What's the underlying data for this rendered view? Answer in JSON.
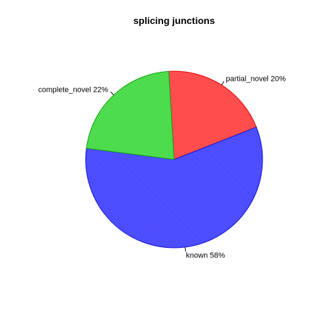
{
  "chart_data": {
    "type": "pie",
    "title": "splicing junctions",
    "start_angle_deg": 93.5,
    "direction": "clockwise",
    "slices": [
      {
        "label": "partial_novel 20%",
        "value": 20,
        "color": "#ff5555",
        "edge": "#e00000",
        "hatch": "#ff0000"
      },
      {
        "label": "known 58%",
        "value": 58,
        "color": "#5555ff",
        "edge": "#1010d0",
        "hatch": "#0000ff"
      },
      {
        "label": "complete_novel 22%",
        "value": 22,
        "color": "#55dd55",
        "edge": "#10a010",
        "hatch": "#00cc00"
      }
    ]
  }
}
